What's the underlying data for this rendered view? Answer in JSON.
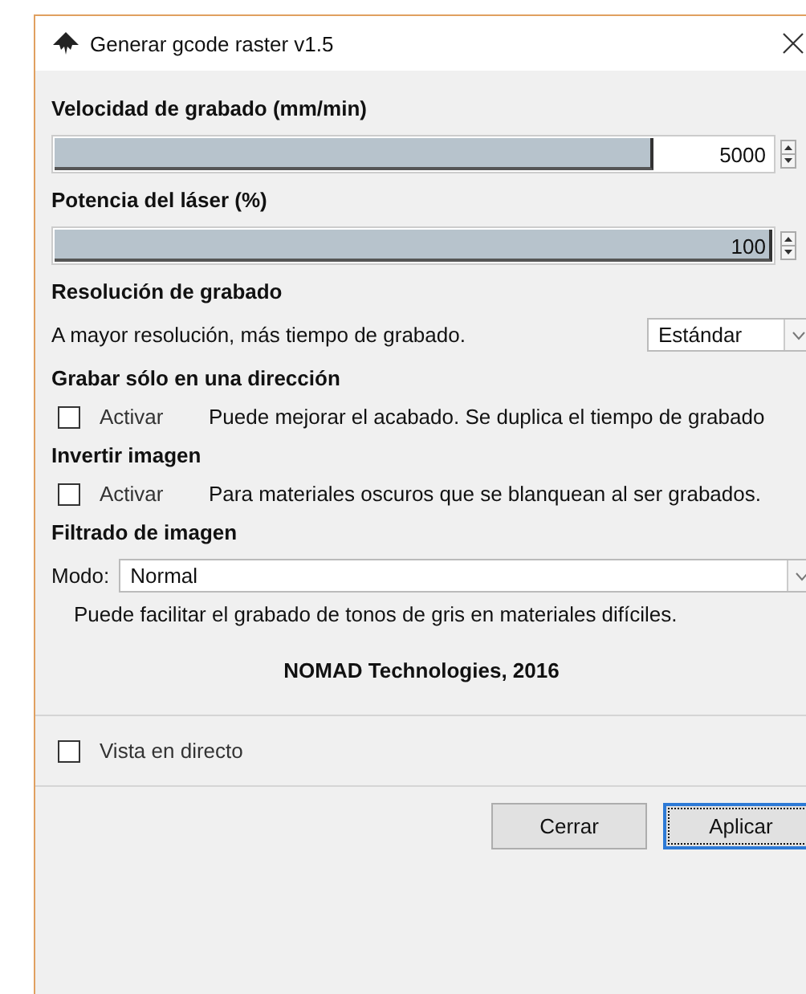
{
  "window": {
    "title": "Generar gcode raster v1.5"
  },
  "sections": [
    {
      "kind": "slider",
      "heading": "Velocidad de grabado (mm/min)",
      "level": 0.83,
      "value": "5000"
    },
    {
      "kind": "slider",
      "heading": "Potencia del láser (%)",
      "level": 1,
      "value": "100"
    },
    {
      "kind": "select",
      "heading": "Resolución de grabado",
      "text": "A mayor resolución, más tiempo de grabado.",
      "value": "Estándar"
    },
    {
      "kind": "checkbox",
      "heading": "Grabar sólo en una dirección",
      "label": "Activar",
      "checked": false,
      "note": "Puede mejorar el acabado. Se duplica el tiempo de grabado"
    },
    {
      "kind": "checkbox",
      "heading": "Invertir imagen",
      "label": "Activar",
      "checked": false,
      "note": "Para materiales oscuros que se blanquean al ser grabados."
    },
    {
      "kind": "mode",
      "heading": "Filtrado de imagen",
      "label": "Modo:",
      "value": "Normal",
      "note": "Puede facilitar el grabado de tonos de gris en materiales difíciles."
    }
  ],
  "credit": "NOMAD Technologies, 2016",
  "live_preview": {
    "label": "Vista en directo",
    "checked": false
  },
  "buttons": [
    {
      "label": "Cerrar",
      "default": false
    },
    {
      "label": "Aplicar",
      "default": true
    }
  ]
}
